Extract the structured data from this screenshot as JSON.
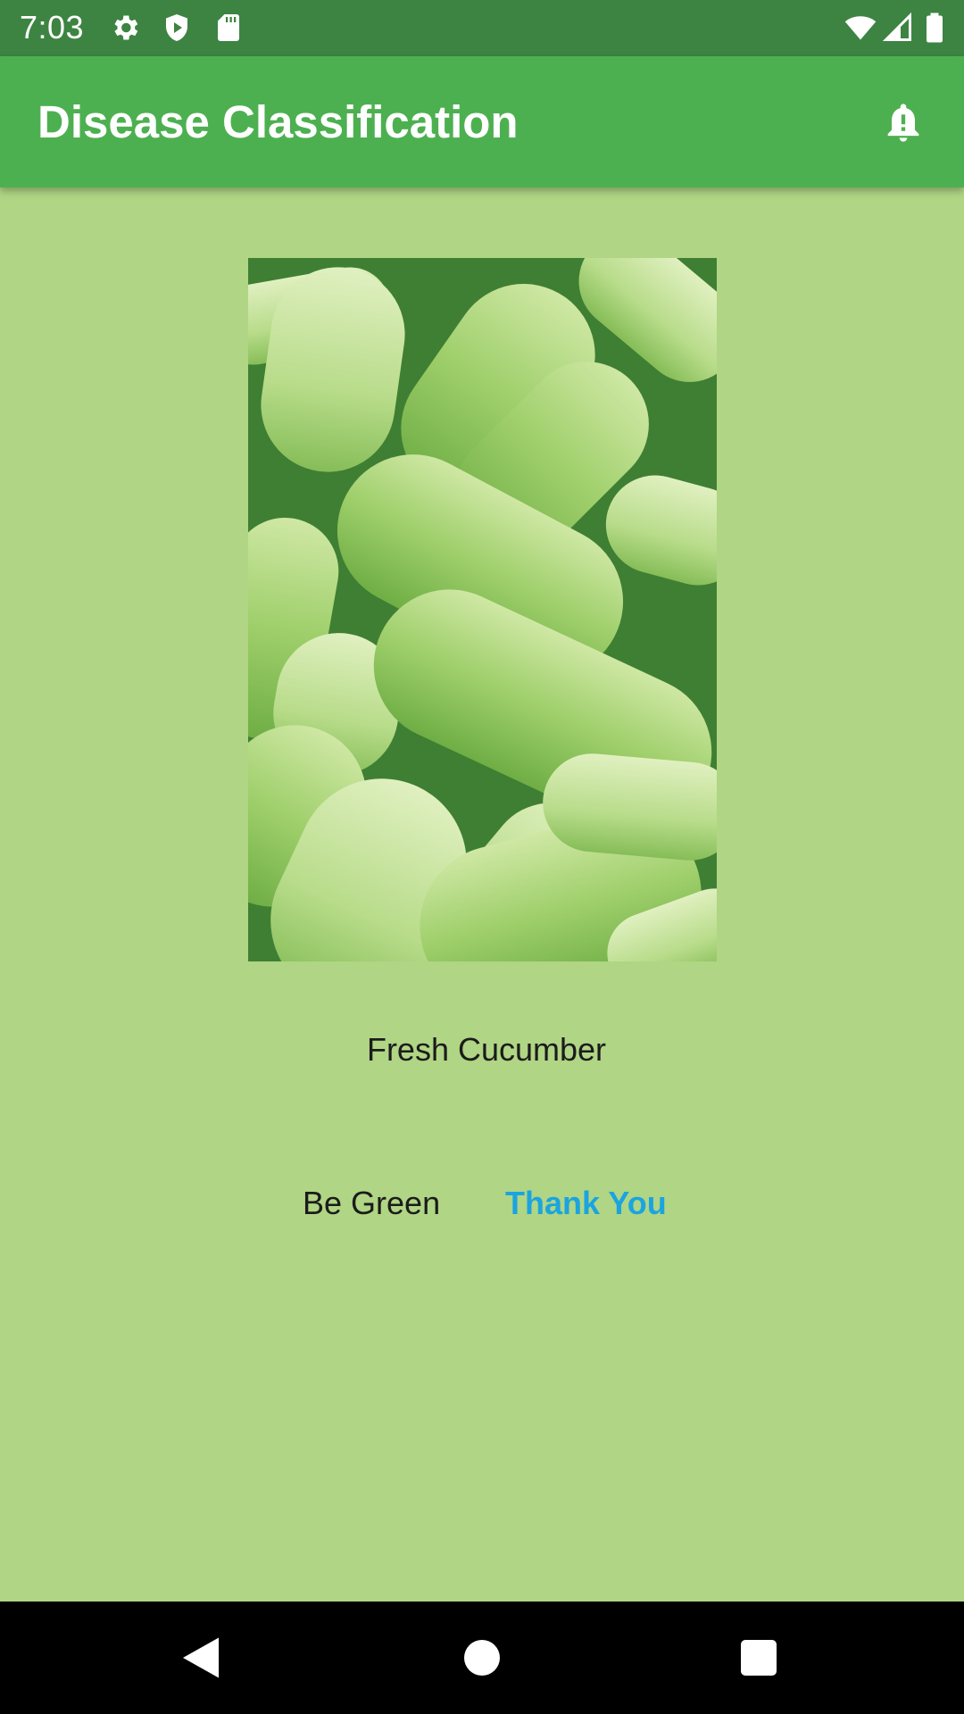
{
  "status_bar": {
    "time": "7:03",
    "left_icons": [
      "gear-icon",
      "shield-play-icon",
      "sd-card-icon"
    ],
    "right_icons": [
      "wifi-icon",
      "cell-signal-icon",
      "battery-icon"
    ]
  },
  "app_bar": {
    "title": "Disease Classification",
    "action_icon": "notification-alert-icon"
  },
  "main": {
    "image_subject": "cucumbers",
    "product_label": "Fresh Cucumber",
    "footer_left": "Be Green",
    "footer_right": "Thank You"
  },
  "nav_bar": {
    "buttons": [
      "back-icon",
      "home-icon",
      "recents-icon"
    ]
  },
  "colors": {
    "status_bar": "#3d8442",
    "app_bar": "#4db050",
    "background": "#b0d584",
    "accent_text": "#1ba4e0"
  }
}
